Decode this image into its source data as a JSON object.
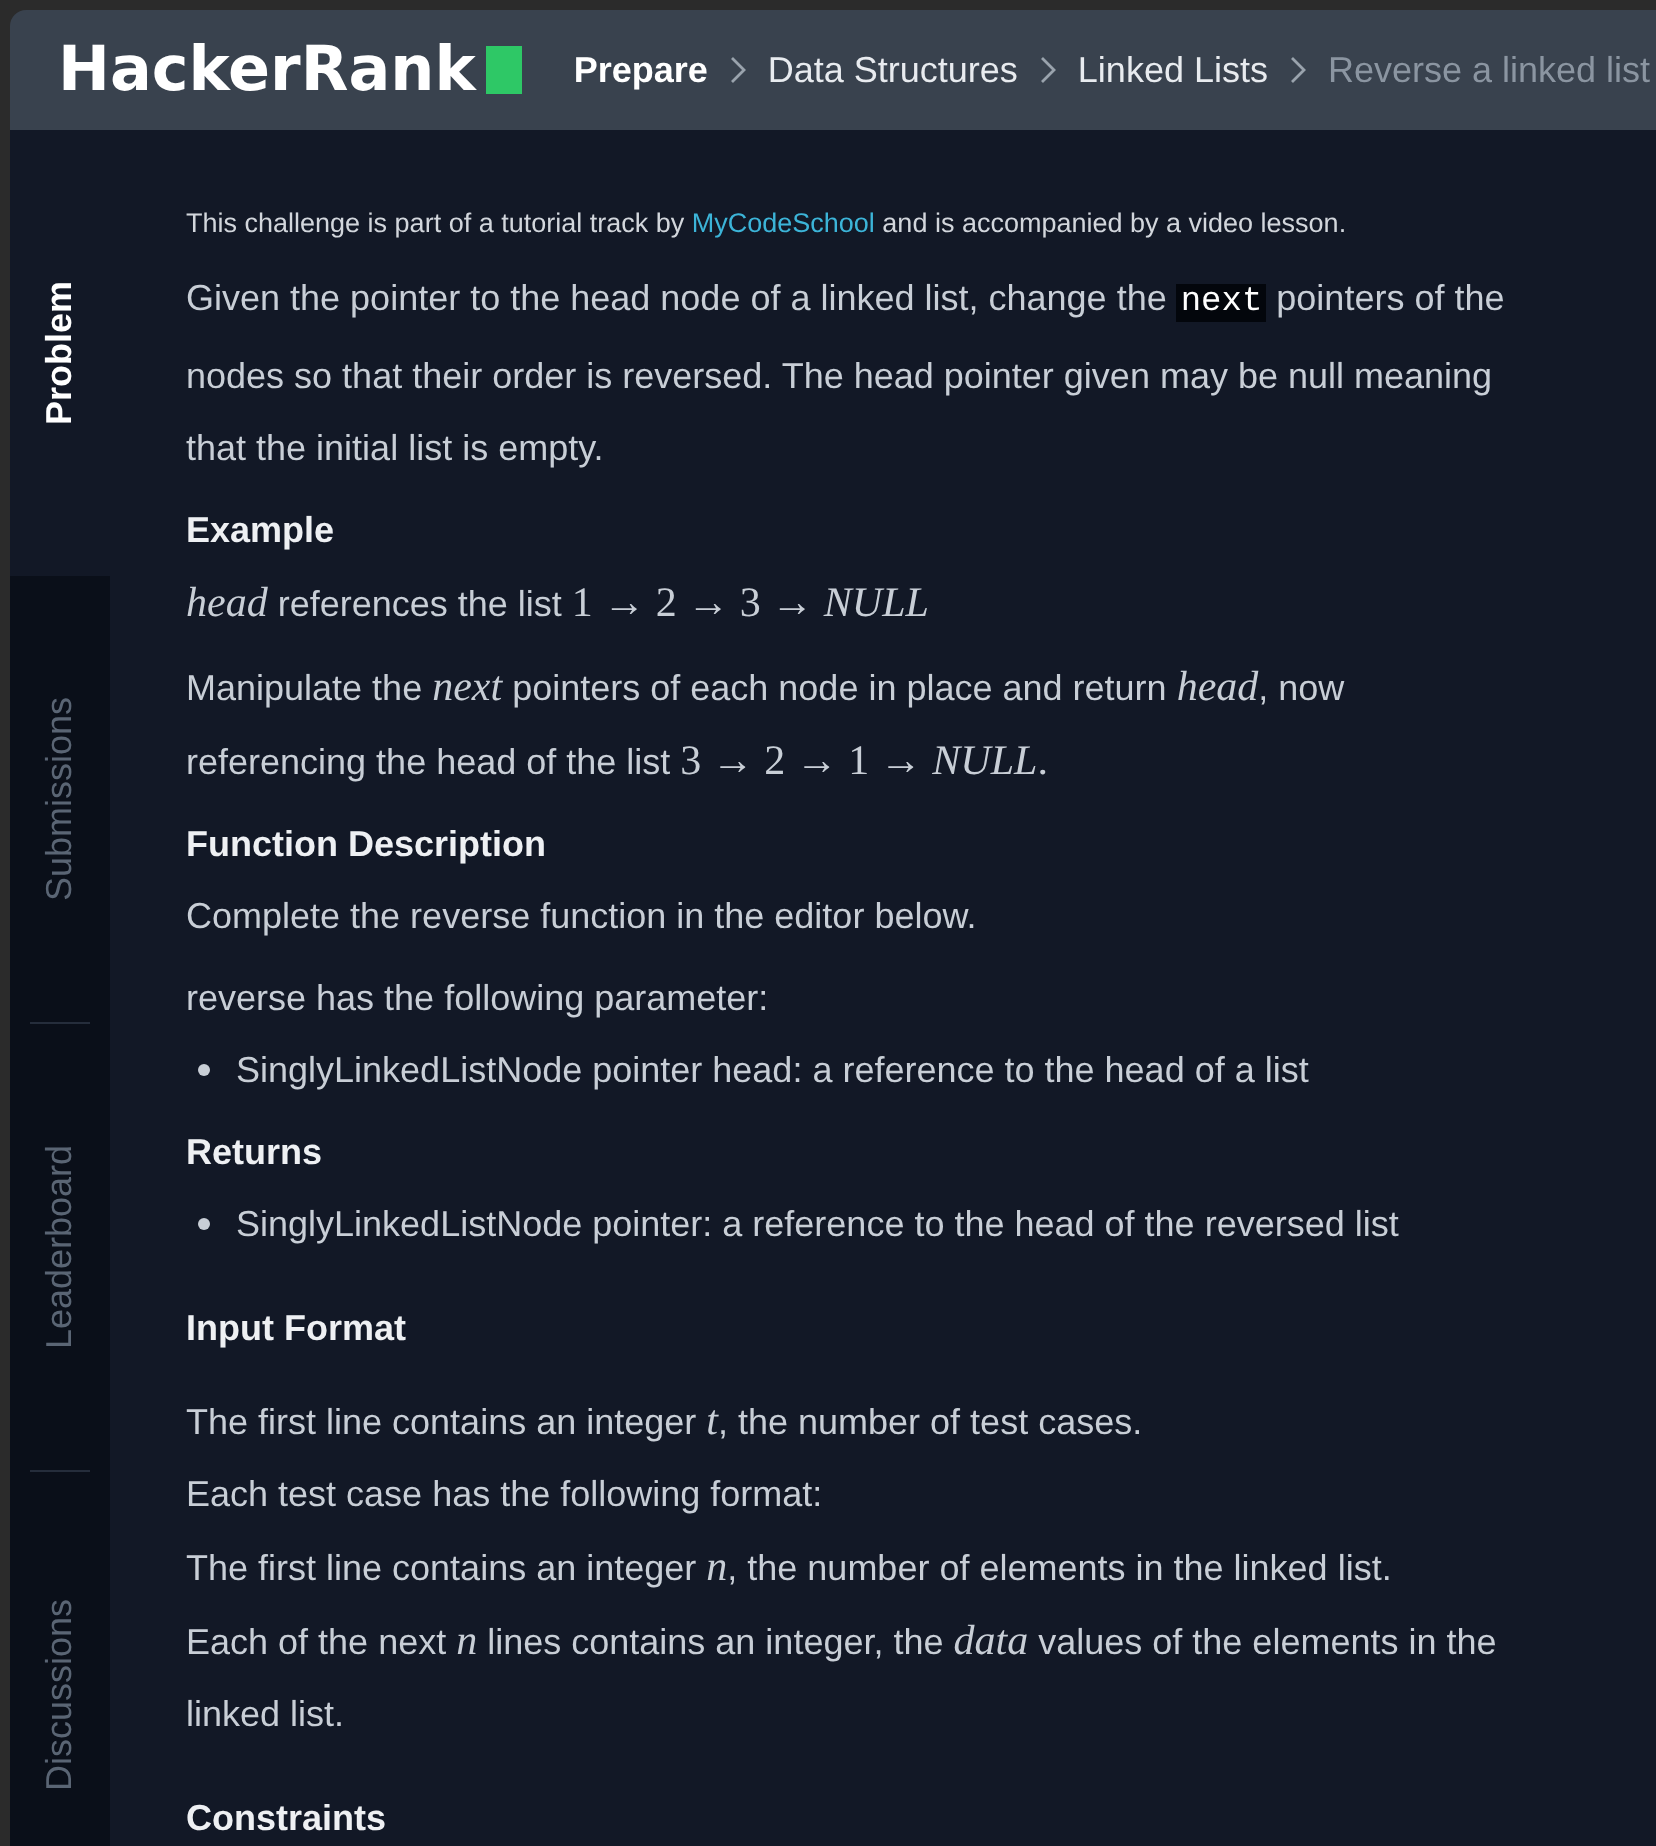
{
  "header": {
    "logo": "HackerRank",
    "breadcrumbs": [
      {
        "label": "Prepare",
        "kind": "root"
      },
      {
        "label": "Data Structures",
        "kind": "link"
      },
      {
        "label": "Linked Lists",
        "kind": "link"
      },
      {
        "label": "Reverse a linked list",
        "kind": "current"
      }
    ]
  },
  "sidebar": {
    "tabs": [
      {
        "label": "Problem",
        "selected": true
      },
      {
        "label": "Submissions",
        "selected": false
      },
      {
        "label": "Leaderboard",
        "selected": false
      },
      {
        "label": "Discussions",
        "selected": false
      }
    ]
  },
  "content": {
    "note": [
      {
        "kind": "text",
        "text": "This challenge is part of a tutorial track by "
      },
      {
        "kind": "link",
        "text": "MyCodeSchool"
      },
      {
        "kind": "text",
        "text": " and is accompanied by a video lesson."
      }
    ],
    "sections": [
      {
        "kind": "statement",
        "blocks": [
          {
            "kind": "paragraph",
            "segments": [
              {
                "kind": "text",
                "text": "Given the pointer to the head node of a linked list, change the "
              },
              {
                "kind": "code",
                "text": "next"
              },
              {
                "kind": "text",
                "text": " pointers of the nodes so that their order is reversed. The head pointer given may be null meaning that the initial list is empty."
              }
            ]
          },
          {
            "kind": "heading",
            "text": "Example"
          },
          {
            "kind": "paragraph",
            "segments": [
              {
                "kind": "math",
                "text": "head"
              },
              {
                "kind": "text",
                "text": " references the list "
              },
              {
                "kind": "mathrm",
                "text": "1 → 2 → 3 → "
              },
              {
                "kind": "math",
                "text": "NULL"
              }
            ]
          },
          {
            "kind": "paragraph",
            "segments": [
              {
                "kind": "text",
                "text": "Manipulate the "
              },
              {
                "kind": "math",
                "text": "next"
              },
              {
                "kind": "text",
                "text": " pointers of each node in place and return "
              },
              {
                "kind": "math",
                "text": "head"
              },
              {
                "kind": "text",
                "text": ", now referencing the head of the list "
              },
              {
                "kind": "mathrm",
                "text": "3 → 2 → 1 → "
              },
              {
                "kind": "math",
                "text": "NULL"
              },
              {
                "kind": "mathrm",
                "text": "."
              }
            ]
          },
          {
            "kind": "heading",
            "text": "Function Description"
          },
          {
            "kind": "paragraph",
            "segments": [
              {
                "kind": "text",
                "text": "Complete the reverse function in the editor below."
              }
            ]
          },
          {
            "kind": "paragraph",
            "segments": [
              {
                "kind": "text",
                "text": "reverse has the following parameter:"
              }
            ]
          },
          {
            "kind": "bullets",
            "items": [
              "SinglyLinkedListNode pointer head: a reference to the head of a list"
            ]
          },
          {
            "kind": "heading",
            "text": "Returns"
          },
          {
            "kind": "bullets",
            "items": [
              "SinglyLinkedListNode pointer: a reference to the head of the reversed list"
            ]
          }
        ]
      },
      {
        "kind": "format",
        "title": "Input Format",
        "blocks": [
          {
            "kind": "paragraph",
            "segments": [
              {
                "kind": "text",
                "text": "The first line contains an integer "
              },
              {
                "kind": "math",
                "text": "t"
              },
              {
                "kind": "text",
                "text": ", the number of test cases."
              }
            ]
          },
          {
            "kind": "paragraph",
            "segments": [
              {
                "kind": "text",
                "text": "Each test case has the following format:"
              }
            ]
          },
          {
            "kind": "paragraph",
            "segments": [
              {
                "kind": "text",
                "text": "The first line contains an integer "
              },
              {
                "kind": "math",
                "text": "n"
              },
              {
                "kind": "text",
                "text": ", the number of elements in the linked list."
              }
            ]
          },
          {
            "kind": "paragraph",
            "segments": [
              {
                "kind": "text",
                "text": "Each of the next "
              },
              {
                "kind": "math",
                "text": "n"
              },
              {
                "kind": "text",
                "text": " lines contains an integer, the "
              },
              {
                "kind": "math",
                "text": "data"
              },
              {
                "kind": "text",
                "text": " values of the elements in the linked list."
              }
            ]
          }
        ]
      },
      {
        "kind": "format",
        "title": "Constraints"
      }
    ]
  }
}
